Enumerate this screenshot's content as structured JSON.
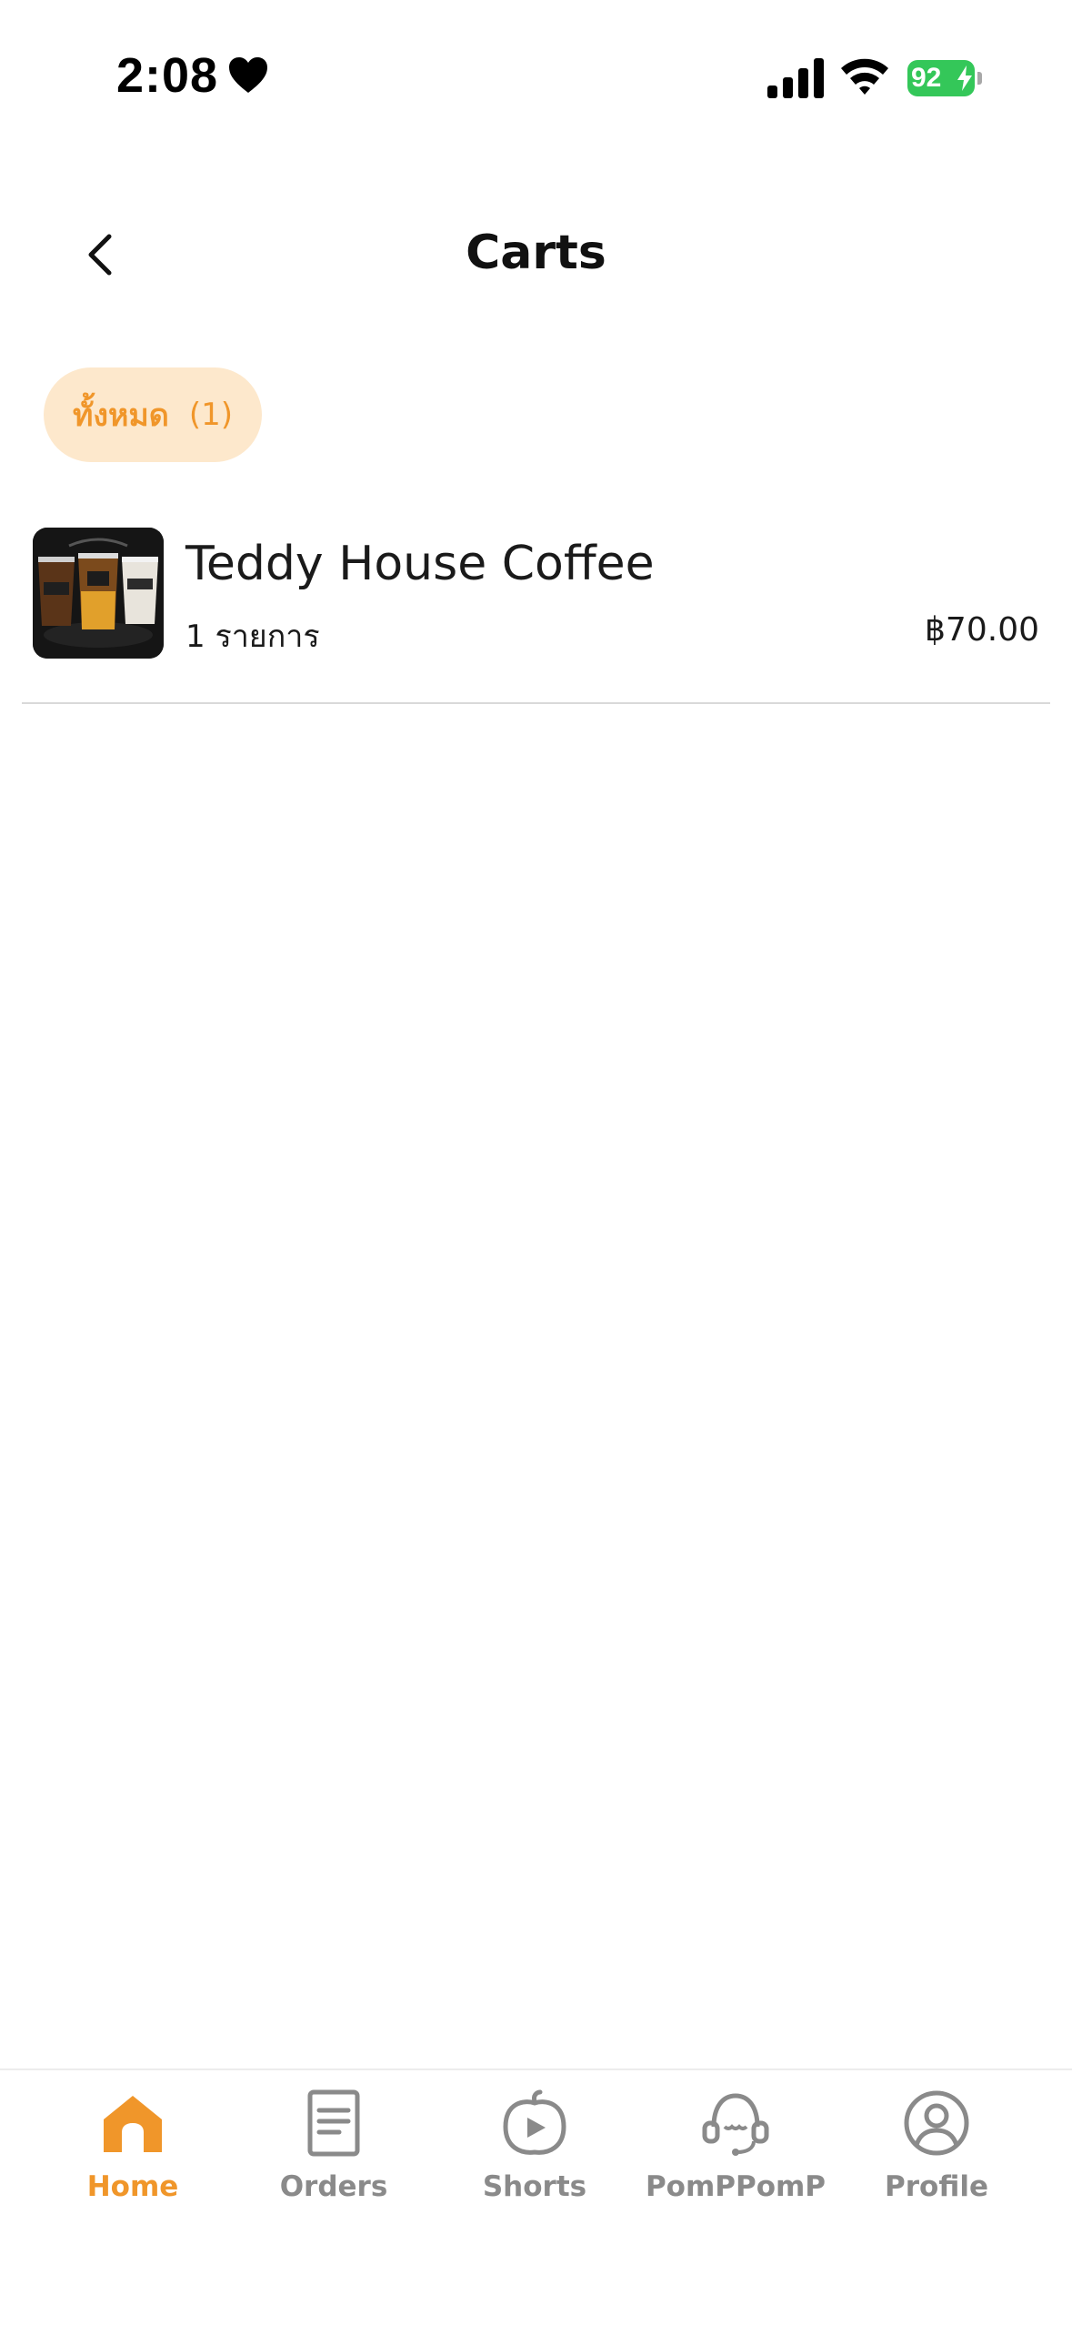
{
  "status_bar": {
    "time": "2:08",
    "battery": "92"
  },
  "header": {
    "title": "Carts"
  },
  "filter": {
    "label": "ทั้งหมด",
    "count": "(1)"
  },
  "cart": {
    "items": [
      {
        "shop_name": "Teddy House Coffee",
        "item_count": "1 รายการ",
        "total": "฿70.00"
      }
    ]
  },
  "bottom_nav": {
    "items": [
      {
        "label": "Home",
        "icon": "home-icon",
        "active": true
      },
      {
        "label": "Orders",
        "icon": "document-icon",
        "active": false
      },
      {
        "label": "Shorts",
        "icon": "pumpkin-play-icon",
        "active": false
      },
      {
        "label": "PomPPomP",
        "icon": "headset-icon",
        "active": false
      },
      {
        "label": "Profile",
        "icon": "user-circle-icon",
        "active": false
      }
    ]
  },
  "colors": {
    "accent": "#f0962a",
    "chip_bg": "#fde8cc",
    "inactive": "#8a8a8a",
    "battery": "#34c759"
  }
}
